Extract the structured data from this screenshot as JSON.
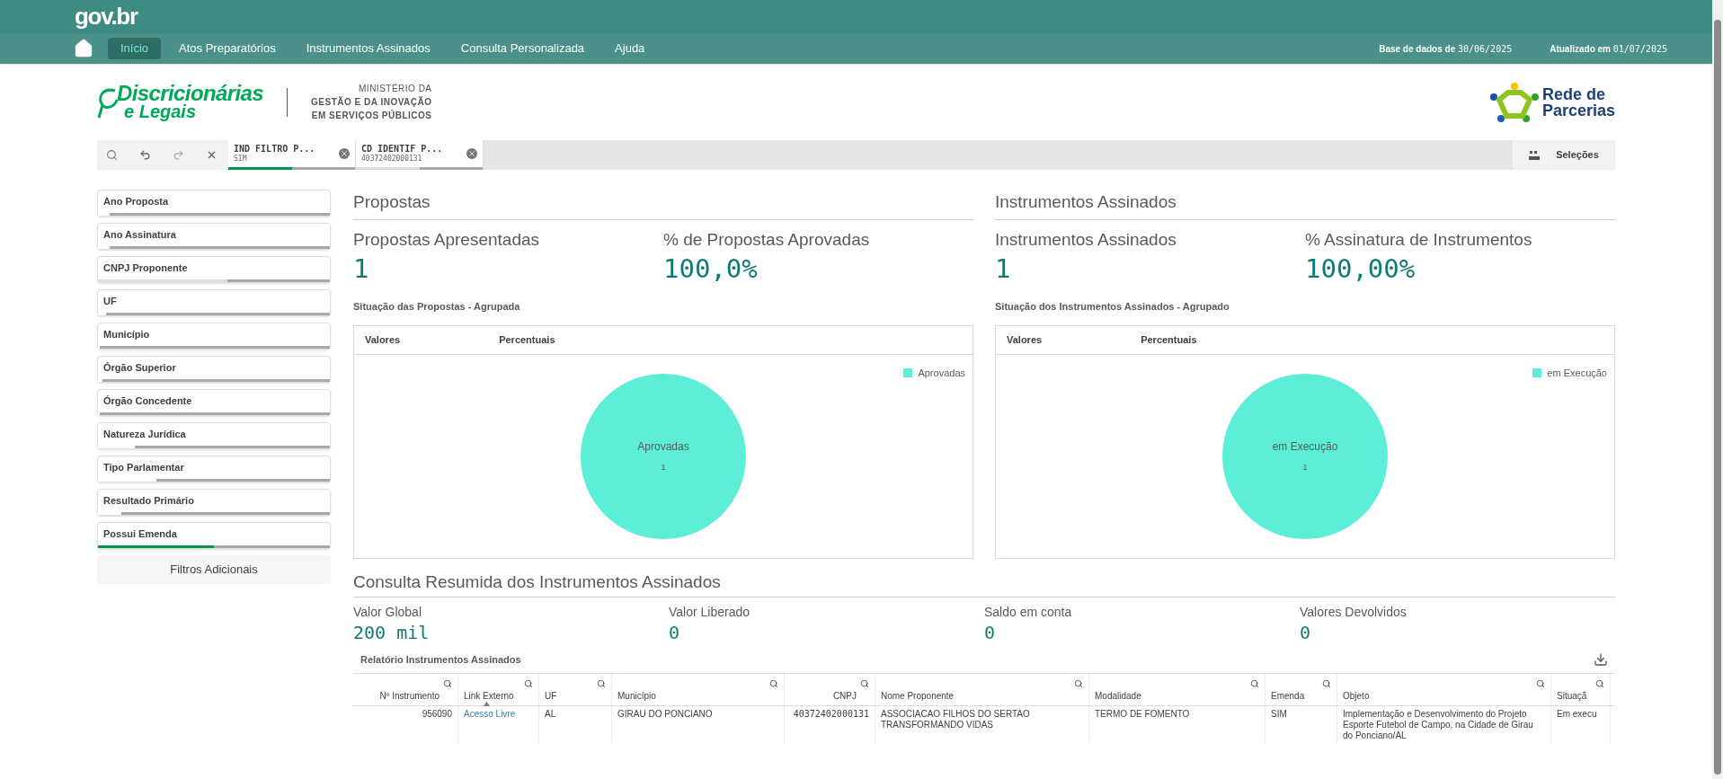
{
  "header": {
    "brand": "gov.br",
    "nav": [
      {
        "label": "Início",
        "selected": true
      },
      {
        "label": "Atos Preparatórios",
        "selected": false
      },
      {
        "label": "Instrumentos Assinados",
        "selected": false
      },
      {
        "label": "Consulta Personalizada",
        "selected": false
      },
      {
        "label": "Ajuda",
        "selected": false
      }
    ],
    "base_label": "Base de dados de",
    "base_date": "30/06/2025",
    "updated_label": "Atualizado em",
    "updated_date": "01/07/2025"
  },
  "logos": {
    "program_line_1": "Discricionárias",
    "program_line_2": "e Legais",
    "ministry": [
      "MINISTÉRIO DA",
      "GESTÃO E DA INOVAÇÃO",
      "EM SERVIÇOS PÚBLICOS"
    ],
    "partner_line_1": "Rede de",
    "partner_line_2": "Parcerias"
  },
  "selections_bar": {
    "chips": [
      {
        "title": "IND FILTRO P...",
        "value": "SIM",
        "level": 0.5,
        "selected": true,
        "alternative": false
      },
      {
        "title": "CD IDENTIF P...",
        "value": "40372402000131",
        "level": 0.5,
        "selected": false,
        "alternative": true
      }
    ],
    "selections_label": "Seleções"
  },
  "filters": [
    {
      "label": "Ano Proposta",
      "level": 0.05,
      "selected": false,
      "alternative": false
    },
    {
      "label": "Ano Assinatura",
      "level": 0.05,
      "selected": false,
      "alternative": false
    },
    {
      "label": "CNPJ Proponente",
      "level": 0.56,
      "selected": false,
      "alternative": true
    },
    {
      "label": "UF",
      "level": 0.035,
      "selected": false,
      "alternative": false
    },
    {
      "label": "Município",
      "level": 0.005,
      "selected": false,
      "alternative": false
    },
    {
      "label": "Órgão Superior",
      "level": 0.02,
      "selected": false,
      "alternative": false
    },
    {
      "label": "Órgão Concedente",
      "level": 0.005,
      "selected": false,
      "alternative": false
    },
    {
      "label": "Natureza Jurídica",
      "level": 0.16,
      "selected": false,
      "alternative": false
    },
    {
      "label": "Tipo Parlamentar",
      "level": 0.25,
      "selected": false,
      "alternative": false
    },
    {
      "label": "Resultado Primário",
      "level": 0.1,
      "selected": false,
      "alternative": false
    },
    {
      "label": "Possui Emenda",
      "level": 0.5,
      "selected": true,
      "alternative": false
    }
  ],
  "additional_filters": "Filtros Adicionais",
  "sections": [
    {
      "title": "Propostas",
      "kpis": [
        {
          "label": "Propostas Apresentadas",
          "value": "1"
        },
        {
          "label": "% de Propostas Aprovadas",
          "value": "100,0%"
        }
      ],
      "chart_title": "Situação das Propostas - Agrupada",
      "tabs": [
        "Valores",
        "Percentuais"
      ],
      "chart_data": {
        "type": "pie",
        "categories": [
          "Aprovadas"
        ],
        "series": [
          {
            "name": "Aprovadas",
            "color": "#5ceed6",
            "values": [
              1
            ]
          }
        ],
        "data_labels": true
      }
    },
    {
      "title": "Instrumentos Assinados",
      "kpis": [
        {
          "label": "Instrumentos Assinados",
          "value": "1"
        },
        {
          "label": "% Assinatura de Instrumentos",
          "value": "100,00%"
        }
      ],
      "chart_title": "Situação dos Instrumentos Assinados - Agrupado",
      "tabs": [
        "Valores",
        "Percentuais"
      ],
      "chart_data": {
        "type": "pie",
        "categories": [
          "em Execução"
        ],
        "series": [
          {
            "name": "em Execução",
            "color": "#5ceed6",
            "values": [
              1
            ]
          }
        ],
        "data_labels": true
      }
    }
  ],
  "summary": {
    "title": "Consulta Resumida dos Instrumentos Assinados",
    "kpis": [
      {
        "label": "Valor Global",
        "value": "200 mil"
      },
      {
        "label": "Valor Liberado",
        "value": "0"
      },
      {
        "label": "Saldo em conta",
        "value": "0"
      },
      {
        "label": "Valores Devolvidos",
        "value": "0"
      }
    ]
  },
  "table": {
    "title": "Relatório Instrumentos Assinados",
    "columns": [
      {
        "label": "Nº Instrumento",
        "sorted": false
      },
      {
        "label": "Link Externo",
        "sorted": true
      },
      {
        "label": "UF",
        "sorted": false
      },
      {
        "label": "Município",
        "sorted": false
      },
      {
        "label": "CNPJ",
        "sorted": false
      },
      {
        "label": "Nome Proponente",
        "sorted": false
      },
      {
        "label": "Modalidade",
        "sorted": false
      },
      {
        "label": "Emenda",
        "sorted": false
      },
      {
        "label": "Objeto",
        "sorted": false
      },
      {
        "label": "Situaçã",
        "sorted": false
      }
    ],
    "rows": [
      [
        {
          "text": "956090",
          "kind": "number"
        },
        {
          "text": "Acesso Livre",
          "kind": "link"
        },
        {
          "text": "AL",
          "kind": "text"
        },
        {
          "text": "GIRAU DO PONCIANO",
          "kind": "text"
        },
        {
          "text": "40372402000131",
          "kind": "mono"
        },
        {
          "text": "ASSOCIACAO FILHOS DO SERTAO TRANSFORMANDO VIDAS",
          "kind": "text"
        },
        {
          "text": "TERMO DE FOMENTO",
          "kind": "text"
        },
        {
          "text": "SIM",
          "kind": "text"
        },
        {
          "text": "Implementação e Desenvolvimento do Projeto Esporte Futebol de Campo, na Cidade de Girau do Ponciano/AL",
          "kind": "text"
        },
        {
          "text": "Em execu",
          "kind": "text"
        }
      ]
    ]
  }
}
